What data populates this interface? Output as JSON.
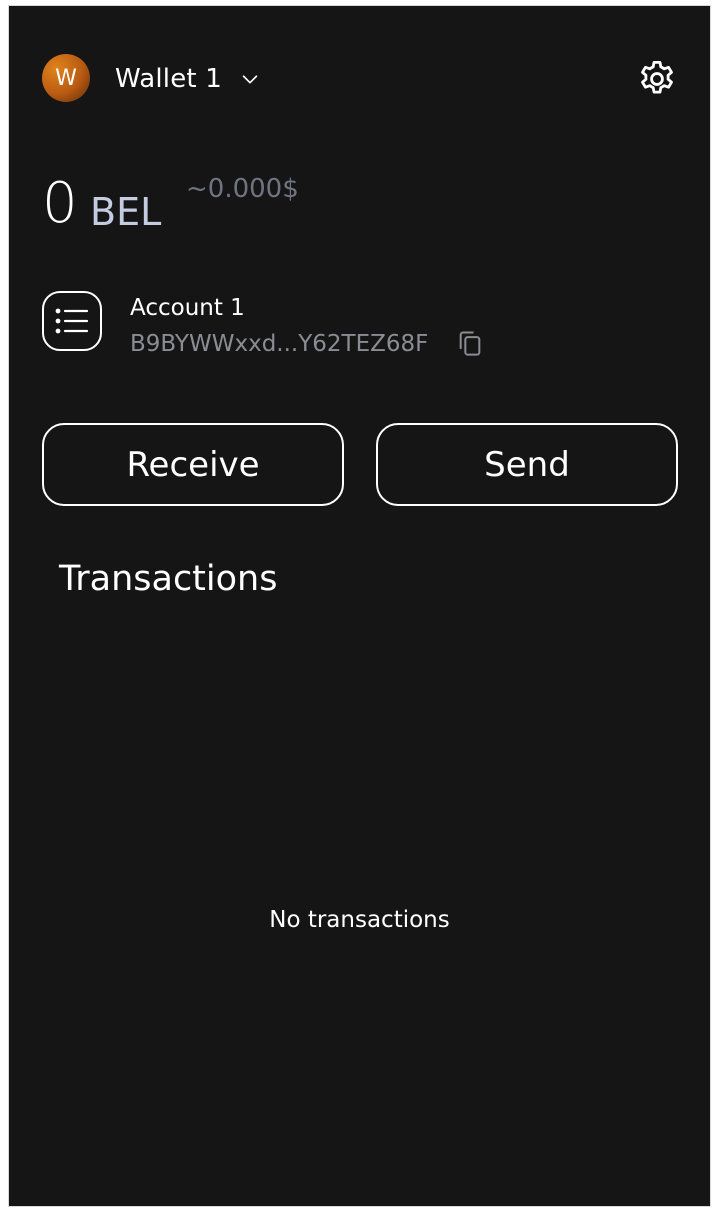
{
  "header": {
    "avatar_letter": "W",
    "avatar_colors": [
      "#e0831c",
      "#b85a12",
      "#5a2a0a"
    ],
    "wallet_name": "Wallet 1",
    "dropdown_icon": "chevron-down-icon",
    "settings_icon": "gear-icon"
  },
  "balance": {
    "amount": "0",
    "unit": "BEL",
    "usd": "~0.000$"
  },
  "account": {
    "icon": "list-icon",
    "name": "Account 1",
    "address": "B9BYWWxxd...Y62TEZ68F",
    "copy_icon": "copy-icon"
  },
  "actions": {
    "receive_label": "Receive",
    "send_label": "Send"
  },
  "transactions": {
    "title": "Transactions",
    "empty_text": "No transactions"
  },
  "colors": {
    "background": "#151515",
    "text": "#ffffff",
    "unit": "#c5cbe0",
    "muted": "#6f7480",
    "address": "#8a8d94"
  }
}
